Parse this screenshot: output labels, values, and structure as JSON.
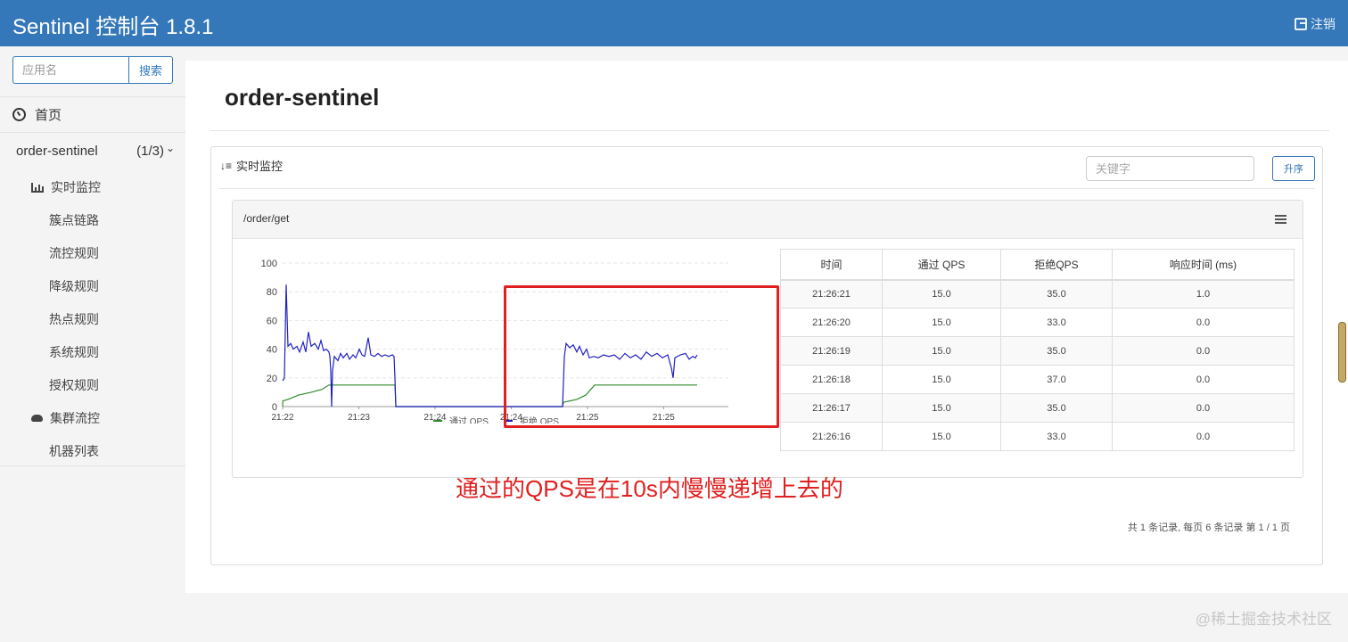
{
  "header": {
    "title": "Sentinel 控制台 1.8.1",
    "logout_label": "注销"
  },
  "sidebar": {
    "search_placeholder": "应用名",
    "search_button": "搜索",
    "home_label": "首页",
    "app_name": "order-sentinel",
    "app_count": "(1/3)",
    "items": [
      {
        "label": "实时监控",
        "icon": "bar-chart-icon"
      },
      {
        "label": "簇点链路"
      },
      {
        "label": "流控规则"
      },
      {
        "label": "降级规则"
      },
      {
        "label": "热点规则"
      },
      {
        "label": "系统规则"
      },
      {
        "label": "授权规则"
      },
      {
        "label": "集群流控",
        "icon": "cloud-icon"
      },
      {
        "label": "机器列表"
      }
    ]
  },
  "main": {
    "page_title": "order-sentinel",
    "panel_title": "实时监控",
    "keyword_placeholder": "关键字",
    "sort_button": "升序",
    "resource": "/order/get",
    "pager": "共 1 条记录, 每页 6 条记录 第 1 / 1 页"
  },
  "table": {
    "headers": [
      "时间",
      "通过 QPS",
      "拒绝QPS",
      "响应时间 (ms)"
    ],
    "rows": [
      [
        "21:26:21",
        "15.0",
        "35.0",
        "1.0"
      ],
      [
        "21:26:20",
        "15.0",
        "33.0",
        "0.0"
      ],
      [
        "21:26:19",
        "15.0",
        "35.0",
        "0.0"
      ],
      [
        "21:26:18",
        "15.0",
        "37.0",
        "0.0"
      ],
      [
        "21:26:17",
        "15.0",
        "35.0",
        "0.0"
      ],
      [
        "21:26:16",
        "15.0",
        "33.0",
        "0.0"
      ]
    ]
  },
  "chart_data": {
    "type": "line",
    "ylim": [
      0,
      100
    ],
    "yticks": [
      0,
      20,
      40,
      60,
      80,
      100
    ],
    "xticks": [
      "21:22",
      "21:23",
      "21:24",
      "21:24",
      "21:25",
      "21:25"
    ],
    "grid": true,
    "legend_position": "bottom",
    "series": [
      {
        "name": "通过 QPS",
        "color": "#2e8b2e",
        "points": [
          [
            0,
            0
          ],
          [
            0.3,
            4
          ],
          [
            6,
            5
          ],
          [
            18,
            8
          ],
          [
            32,
            10
          ],
          [
            44,
            12
          ],
          [
            52,
            15
          ],
          [
            58,
            15
          ],
          [
            75,
            15
          ],
          [
            100,
            15
          ],
          [
            123,
            15
          ],
          [
            126,
            15
          ],
          [
            127,
            0
          ],
          [
            200,
            0
          ],
          [
            300,
            0
          ],
          [
            314,
            0
          ],
          [
            315,
            3
          ],
          [
            330,
            5
          ],
          [
            340,
            8
          ],
          [
            350,
            15
          ],
          [
            380,
            15
          ],
          [
            420,
            15
          ],
          [
            460,
            15
          ],
          [
            465,
            15
          ]
        ]
      },
      {
        "name": "拒绝 QPS",
        "color": "#2121c0",
        "points": [
          [
            0,
            18
          ],
          [
            2,
            20
          ],
          [
            4,
            85
          ],
          [
            6,
            42
          ],
          [
            9,
            44
          ],
          [
            12,
            40
          ],
          [
            16,
            42
          ],
          [
            19,
            38
          ],
          [
            23,
            45
          ],
          [
            26,
            38
          ],
          [
            29,
            52
          ],
          [
            32,
            42
          ],
          [
            36,
            44
          ],
          [
            40,
            40
          ],
          [
            43,
            46
          ],
          [
            46,
            39
          ],
          [
            49,
            40
          ],
          [
            52,
            38
          ],
          [
            53,
            35
          ],
          [
            54,
            25
          ],
          [
            55,
            0
          ],
          [
            56,
            25
          ],
          [
            58,
            35
          ],
          [
            62,
            32
          ],
          [
            65,
            37
          ],
          [
            68,
            34
          ],
          [
            72,
            37
          ],
          [
            75,
            33
          ],
          [
            79,
            36
          ],
          [
            82,
            34
          ],
          [
            86,
            40
          ],
          [
            89,
            36
          ],
          [
            92,
            35
          ],
          [
            96,
            48
          ],
          [
            99,
            36
          ],
          [
            103,
            35
          ],
          [
            107,
            37
          ],
          [
            111,
            35
          ],
          [
            115,
            36
          ],
          [
            119,
            35
          ],
          [
            123,
            36
          ],
          [
            125,
            35
          ],
          [
            126,
            20
          ],
          [
            127,
            0
          ],
          [
            200,
            0
          ],
          [
            300,
            0
          ],
          [
            314,
            0
          ],
          [
            316,
            35
          ],
          [
            318,
            44
          ],
          [
            322,
            41
          ],
          [
            326,
            43
          ],
          [
            330,
            38
          ],
          [
            333,
            42
          ],
          [
            337,
            36
          ],
          [
            341,
            40
          ],
          [
            344,
            34
          ],
          [
            349,
            35
          ],
          [
            354,
            34
          ],
          [
            360,
            36
          ],
          [
            366,
            35
          ],
          [
            372,
            36
          ],
          [
            378,
            33
          ],
          [
            384,
            37
          ],
          [
            390,
            34
          ],
          [
            396,
            36
          ],
          [
            402,
            33
          ],
          [
            408,
            38
          ],
          [
            414,
            35
          ],
          [
            420,
            37
          ],
          [
            426,
            34
          ],
          [
            432,
            36
          ],
          [
            436,
            27
          ],
          [
            438,
            20
          ],
          [
            440,
            34
          ],
          [
            446,
            36
          ],
          [
            452,
            37
          ],
          [
            456,
            33
          ],
          [
            460,
            35
          ],
          [
            463,
            34
          ],
          [
            465,
            36
          ]
        ]
      }
    ]
  },
  "annotation": {
    "text": "通过的QPS是在10s内慢慢递增上去的",
    "color": "#e02020"
  },
  "watermark": "@稀土掘金技术社区"
}
